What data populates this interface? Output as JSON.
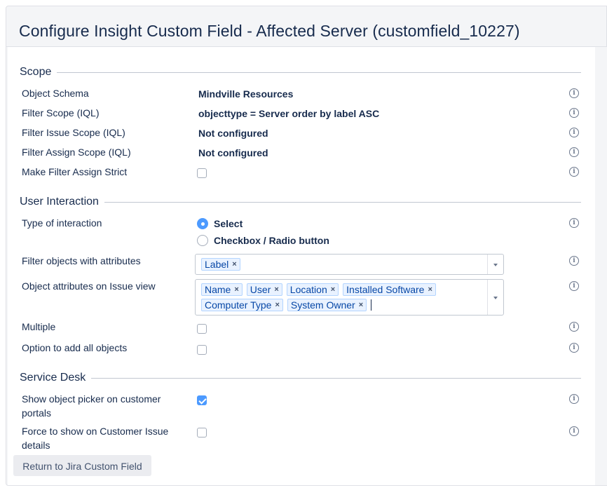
{
  "title": "Configure Insight Custom Field - Affected Server (customfield_10227)",
  "sections": {
    "scope": "Scope",
    "user_interaction": "User Interaction",
    "service_desk": "Service Desk"
  },
  "scope": {
    "object_schema_label": "Object Schema",
    "object_schema_value": "Mindville Resources",
    "filter_scope_label": "Filter Scope (IQL)",
    "filter_scope_value": "objecttype = Server order by label ASC",
    "filter_issue_scope_label": "Filter Issue Scope (IQL)",
    "filter_issue_scope_value": "Not configured",
    "filter_assign_scope_label": "Filter Assign Scope (IQL)",
    "filter_assign_scope_value": "Not configured",
    "make_filter_strict_label": "Make Filter Assign Strict",
    "make_filter_strict_checked": false
  },
  "interaction": {
    "type_label": "Type of interaction",
    "options": [
      "Select",
      "Checkbox / Radio button"
    ],
    "selected": "Select",
    "filter_attrs_label": "Filter objects with attributes",
    "filter_attrs_tags": [
      "Label"
    ],
    "issue_view_attrs_label": "Object attributes on Issue view",
    "issue_view_attrs_tags": [
      "Name",
      "User",
      "Location",
      "Installed Software",
      "Computer Type",
      "System Owner"
    ],
    "multiple_label": "Multiple",
    "multiple_checked": false,
    "add_all_label": "Option to add all objects",
    "add_all_checked": false
  },
  "service_desk": {
    "picker_label_line1": "Show object picker on customer",
    "picker_label_line2": "portals",
    "picker_checked": true,
    "force_label_line1": "Force to show on Customer Issue",
    "force_label_line2": "details",
    "force_checked": false
  },
  "icons": {
    "info": "i",
    "remove": "×"
  },
  "return_button": "Return to Jira Custom Field",
  "colors": {
    "accent": "#4c9aff",
    "tag_bg": "#e9f2ff",
    "tag_text": "#0747a6",
    "text": "#172b4d"
  }
}
